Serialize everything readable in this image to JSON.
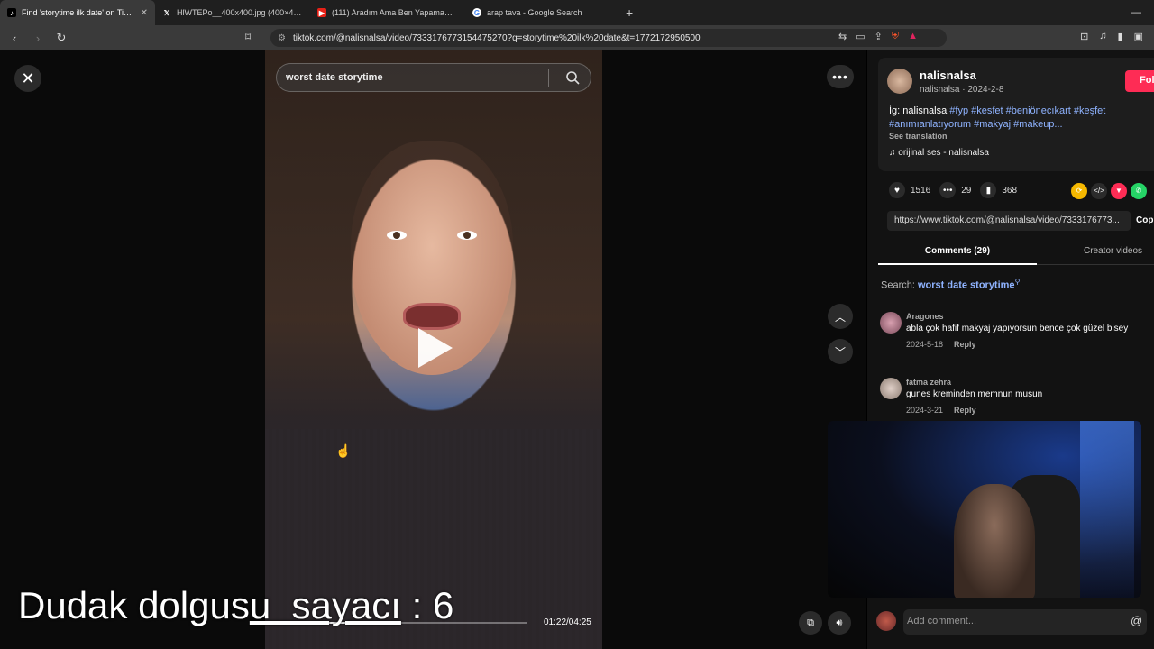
{
  "browser": {
    "tabs": [
      {
        "title": "Find 'storytime ilk date' on TikTo",
        "icon": "tiktok-icon",
        "active": true
      },
      {
        "title": "HlWTEPo__400x400.jpg (400×400)",
        "icon": "x-icon",
        "active": false
      },
      {
        "title": "(111) Aradım Ama Ben Yapamam - Y",
        "icon": "youtube-icon",
        "active": false
      },
      {
        "title": "arap tava - Google Search",
        "icon": "google-icon",
        "active": false
      }
    ],
    "url": "tiktok.com/@nalisnalsa/video/7333176773154475270?q=storytime%20ilk%20date&t=1772172950500"
  },
  "video": {
    "search_text": "worst date storytime",
    "time": "01:22/04:25",
    "progress": 0.31
  },
  "overlay": {
    "prefix": "Dudak dolgus",
    "underlined": "u  sayacı",
    "suffix": " : 6"
  },
  "post": {
    "username": "nalisnalsa",
    "subline": "nalisnalsa · 2024-2-8",
    "follow_label": "Fol",
    "caption_prefix": "İg: nalisnalsa ",
    "caption_tags": "#fyp #kesfet #beniönecıkart #keşfet #anımıanlatıyorum #makyaj #makeup...",
    "see_translation": "See translation",
    "music": "orijinal ses - nalisnalsa",
    "likes": "1516",
    "comments": "29",
    "saves": "368",
    "link": "https://www.tiktok.com/@nalisnalsa/video/7333176773...",
    "copy_label": "Cop"
  },
  "panel": {
    "tab_comments": "Comments (29)",
    "tab_creator": "Creator videos",
    "search_prefix": "Search: ",
    "search_term": "worst date storytime"
  },
  "comments": [
    {
      "user": "Aragones",
      "text": "abla çok hafif makyaj yapıyorsun bence çok güzel bisey",
      "date": "2024-5-18",
      "reply": "Reply"
    },
    {
      "user": "fatma zehra",
      "text": "gunes kreminden memnun musun",
      "date": "2024-3-21",
      "reply": "Reply"
    }
  ],
  "comment_bar": {
    "placeholder": "Add comment..."
  },
  "colors": {
    "accent": "#fe2c55",
    "tag": "#8fb3ff"
  }
}
